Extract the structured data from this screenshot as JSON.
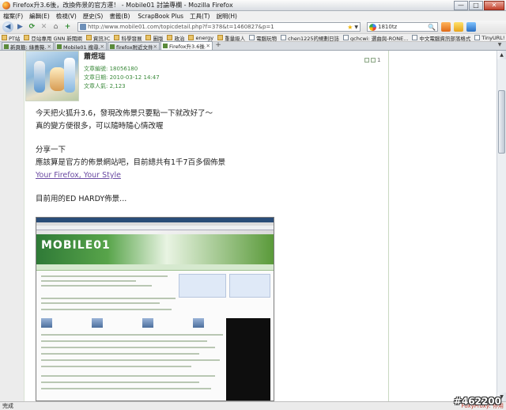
{
  "window": {
    "title": "Firefox升3.6後，改換佈景的官方運！ - Mobile01 討論專欄 - Mozilla Firefox",
    "buttons": {
      "minimize": "—",
      "maximize": "□",
      "close": "✕"
    }
  },
  "menubar": {
    "items": [
      "檔案(F)",
      "編輯(E)",
      "檢視(V)",
      "歷史(S)",
      "書籤(B)",
      "工具(T)",
      "說明(H)"
    ],
    "scrapbook": "ScrapBook Plus"
  },
  "navbar": {
    "back": "◀",
    "forward": "▶",
    "reload": "⟳",
    "stop": "✕",
    "home": "⌂",
    "add": "+",
    "url": "http://www.mobile01.com/topicdetail.php?f=378&t=1460827&p=1",
    "star": "★",
    "search_value": "1810tz",
    "search_icon": "🔍"
  },
  "bookmarks": {
    "items": [
      "PT站",
      "亞站專用 GNN 新聞網",
      "資訊3C",
      "科學發展",
      "圖版",
      "政治",
      "energy",
      "重量級人",
      "電腦玩物",
      "chen1225的規劃日誌",
      "gchcwi: 選曲與-RONE...",
      "中文電腦資訊部落格式",
      "TinyURL!"
    ]
  },
  "tabs": [
    {
      "label": "新頁籤: 綠薔薇...",
      "active": false
    },
    {
      "label": "Mobile01 搜尋...",
      "active": false
    },
    {
      "label": "firefox附近文件...",
      "active": false
    },
    {
      "label": "Firefox升3.6後...",
      "active": true
    }
  ],
  "post": {
    "username": "蕭煜瑞",
    "meta": [
      "文章編號: 18056180",
      "文章日期: 2010-03-12 14:47",
      "文章人氣: 2,123"
    ],
    "floor": "1",
    "lines": [
      "今天把火狐升3.6，發現改佈景只要點一下就改好了～",
      "真的變方便很多，可以隨時隨心情改喔",
      "",
      "分享一下",
      "應該算是官方的佈景網站吧，目前總共有1千7百多個佈景",
      "Your Firefox, Your Style",
      "",
      "目前用的ED HARDY佈景..."
    ],
    "link_text": "Your Firefox, Your Style"
  },
  "embedded": {
    "logo": "MOBILE01"
  },
  "statusbar": {
    "text": "完成",
    "proxy": "FoxyProxy: 停用"
  },
  "watermark": "#462200",
  "colors": {
    "accent_green": "#3b8a3b",
    "link_purple": "#6a4aa2"
  }
}
